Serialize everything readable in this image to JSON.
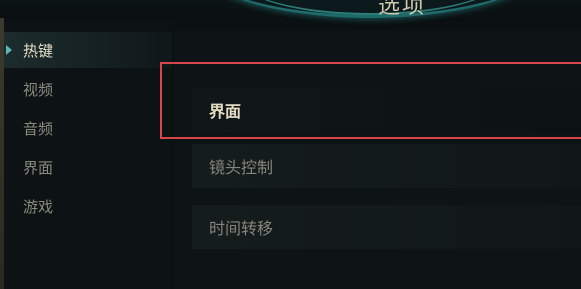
{
  "header": {
    "title": "选项"
  },
  "sidebar": {
    "items": [
      {
        "label": "热键",
        "active": true
      },
      {
        "label": "视频",
        "active": false
      },
      {
        "label": "音频",
        "active": false
      },
      {
        "label": "界面",
        "active": false
      },
      {
        "label": "游戏",
        "active": false
      }
    ]
  },
  "panel": {
    "rows": [
      {
        "label": "界面",
        "highlighted": true
      },
      {
        "label": "镜头控制",
        "highlighted": false
      },
      {
        "label": "时间转移",
        "highlighted": false
      }
    ]
  },
  "colors": {
    "accent_teal": "#5fb6b0",
    "highlight_red": "#d8454a",
    "text_gold": "#e3dcc2"
  }
}
